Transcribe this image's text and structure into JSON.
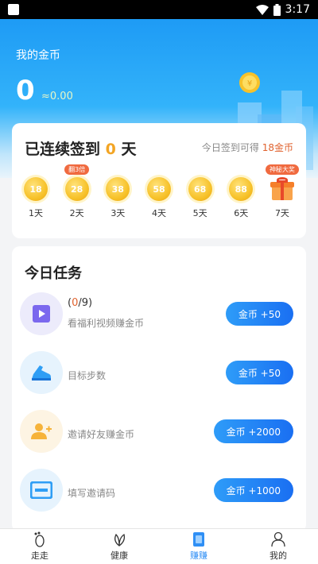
{
  "status_bar": {
    "time": "3:17"
  },
  "header": {
    "title": "我的金币",
    "amount": "0",
    "approx": "≈0.00"
  },
  "signin": {
    "prefix": "已连续签到",
    "count": "0",
    "suffix": "天",
    "hint_prefix": "今日签到可得",
    "hint_reward": "18金币",
    "days": [
      {
        "coins": "18",
        "label": "1天"
      },
      {
        "coins": "28",
        "label": "2天",
        "tag": "翻3倍"
      },
      {
        "coins": "38",
        "label": "3天"
      },
      {
        "coins": "58",
        "label": "4天"
      },
      {
        "coins": "68",
        "label": "5天"
      },
      {
        "coins": "88",
        "label": "6天"
      },
      {
        "label": "7天",
        "tag": "神秘大奖",
        "icon": "gift-icon"
      }
    ]
  },
  "tasks": {
    "title": "今日任务",
    "items": [
      {
        "icon": "video-play-icon",
        "progress_open": "(",
        "progress_done": "0",
        "progress_rest": "/9)",
        "desc": "看福利视频赚金币",
        "button": "金币 +50"
      },
      {
        "icon": "sneaker-icon",
        "desc": "目标步数",
        "button": "金币 +50"
      },
      {
        "icon": "add-friend-icon",
        "desc": "邀请好友赚金币",
        "button": "金币 +2000"
      },
      {
        "icon": "invite-code-icon",
        "desc": "填写邀请码",
        "button": "金币 +1000"
      }
    ]
  },
  "nav": {
    "items": [
      {
        "label": "走走",
        "icon": "footprint-icon"
      },
      {
        "label": "健康",
        "icon": "leaf-icon"
      },
      {
        "label": "赚赚",
        "icon": "earn-icon",
        "active": true
      },
      {
        "label": "我的",
        "icon": "user-icon"
      }
    ]
  },
  "colors": {
    "accent": "#2f8ff5",
    "coin": "#f7c22a",
    "highlight": "#e0622e"
  }
}
